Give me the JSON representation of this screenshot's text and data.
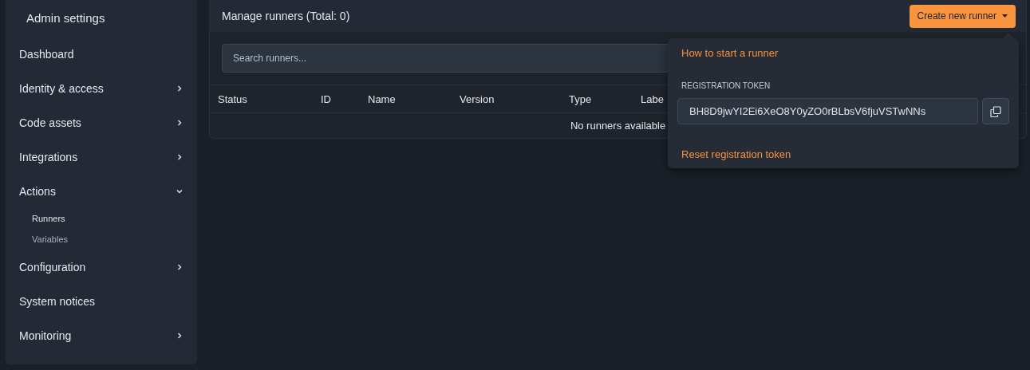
{
  "sidebar": {
    "title": "Admin settings",
    "items": [
      {
        "label": "Dashboard"
      },
      {
        "label": "Identity & access",
        "expanded": false
      },
      {
        "label": "Code assets",
        "expanded": false
      },
      {
        "label": "Integrations",
        "expanded": false
      },
      {
        "label": "Actions",
        "expanded": true,
        "children": [
          {
            "label": "Runners",
            "selected": true
          },
          {
            "label": "Variables",
            "selected": false
          }
        ]
      },
      {
        "label": "Configuration",
        "expanded": false
      },
      {
        "label": "System notices"
      },
      {
        "label": "Monitoring",
        "expanded": false
      }
    ]
  },
  "panel": {
    "title": "Manage runners (Total: 0)",
    "create_button": "Create new runner",
    "search": {
      "placeholder": "Search runners..."
    },
    "table": {
      "columns": [
        "Status",
        "ID",
        "Name",
        "Version",
        "Type",
        "Labe"
      ],
      "empty_message": "No runners available"
    }
  },
  "dropdown": {
    "help_link": "How to start a runner",
    "token_label": "REGISTRATION TOKEN",
    "token": "BH8D9jwYI2Ei6XeO8Y0yZO0rBLbsV6fjuVSTwNNs",
    "reset_link": "Reset registration token"
  }
}
